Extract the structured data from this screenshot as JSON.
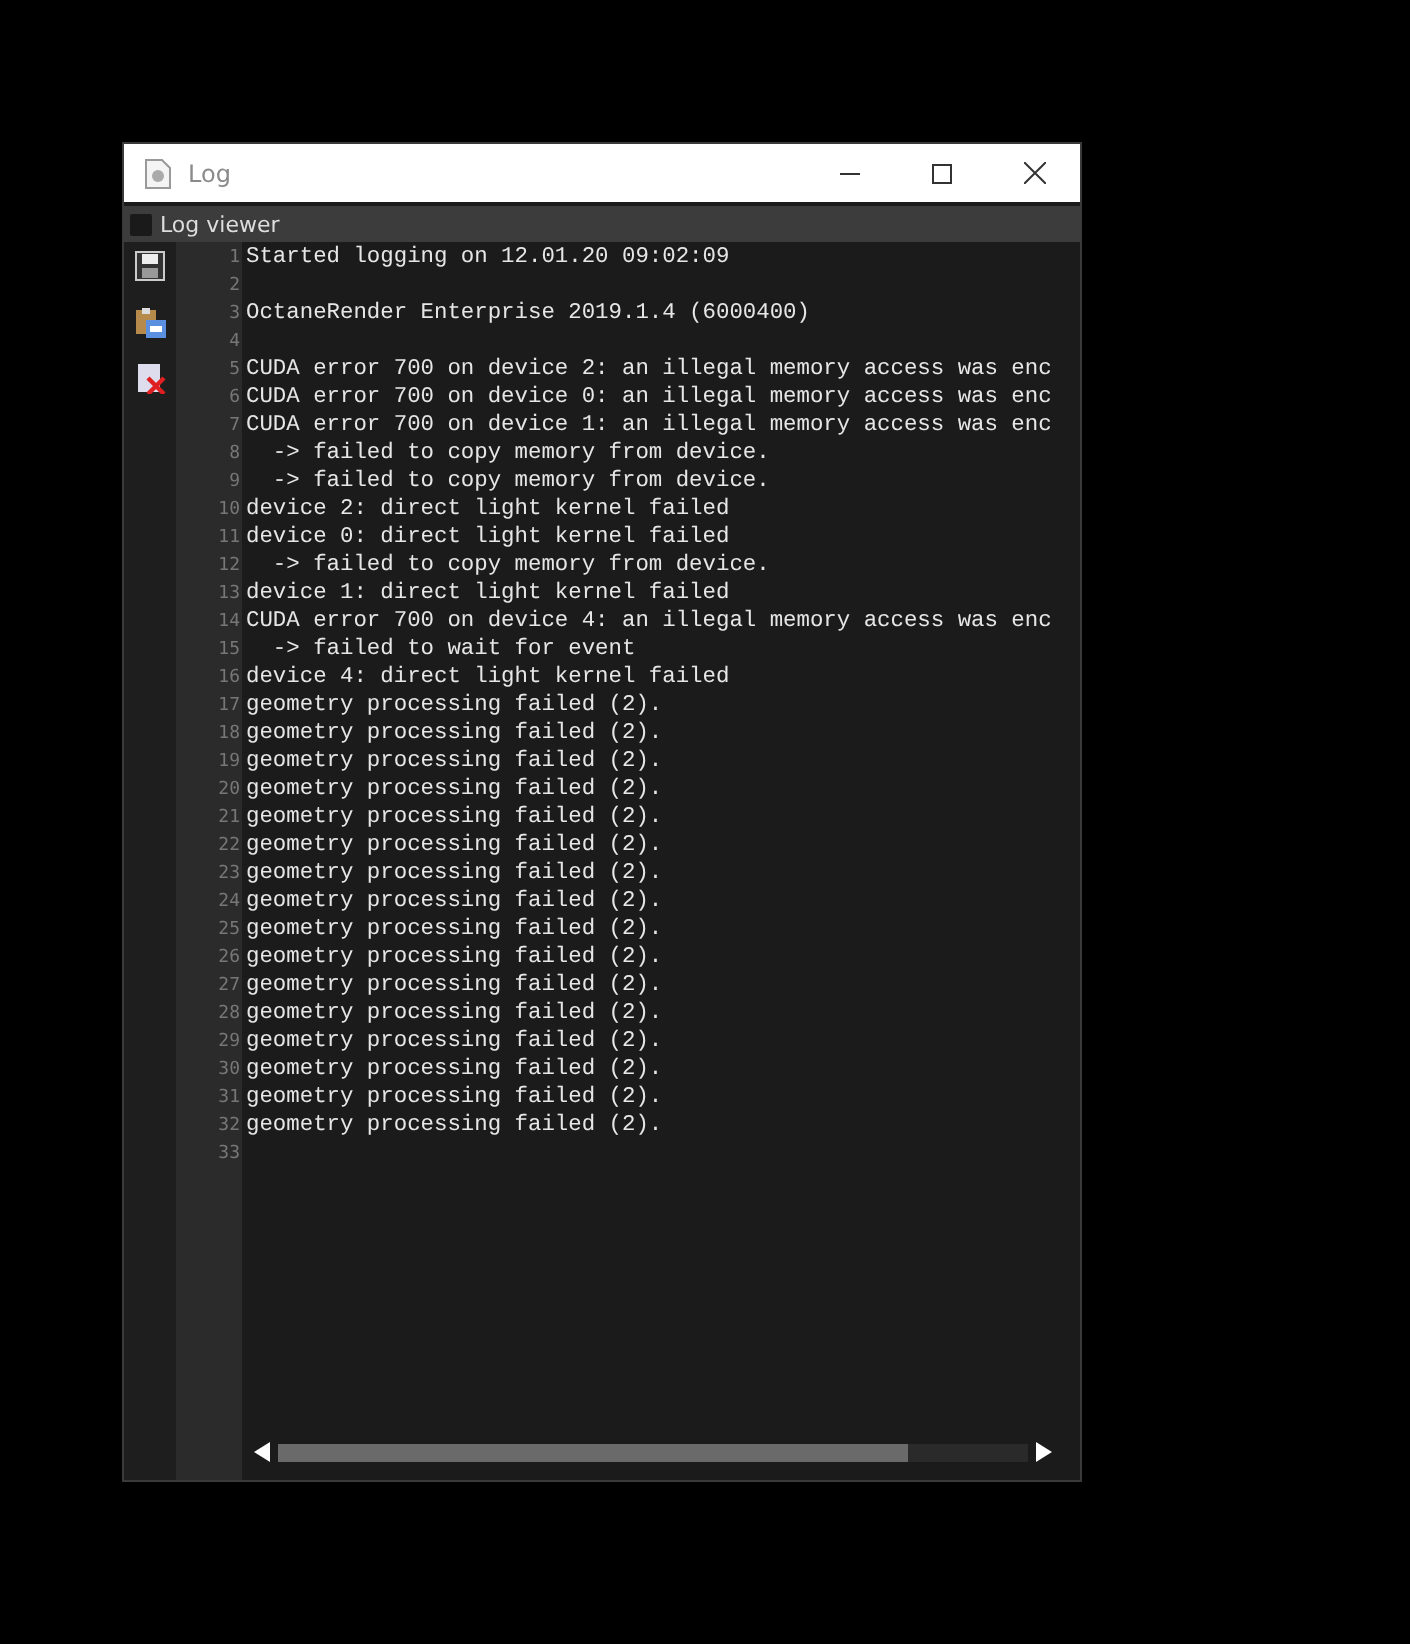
{
  "window": {
    "title": "Log"
  },
  "panel": {
    "label": "Log viewer",
    "checked": false
  },
  "toolbar": [
    {
      "kind": "save"
    },
    {
      "kind": "paste"
    },
    {
      "kind": "clear"
    }
  ],
  "lines": [
    {
      "number": "1",
      "text": "Started logging on 12.01.20 09:02:09"
    },
    {
      "number": "2"
    },
    {
      "number": "3",
      "text": "OctaneRender Enterprise 2019.1.4 (6000400)"
    },
    {
      "number": "4"
    },
    {
      "number": "5",
      "text": "CUDA error 700 on device 2: an illegal memory access was enc"
    },
    {
      "number": "6",
      "text": "CUDA error 700 on device 0: an illegal memory access was enc"
    },
    {
      "number": "7",
      "text": "CUDA error 700 on device 1: an illegal memory access was enc"
    },
    {
      "number": "8",
      "text": "  -> failed to copy memory from device."
    },
    {
      "number": "9",
      "text": "  -> failed to copy memory from device."
    },
    {
      "number": "10",
      "text": "device 2: direct light kernel failed"
    },
    {
      "number": "11",
      "text": "device 0: direct light kernel failed"
    },
    {
      "number": "12",
      "text": "  -> failed to copy memory from device."
    },
    {
      "number": "13",
      "text": "device 1: direct light kernel failed"
    },
    {
      "number": "14",
      "text": "CUDA error 700 on device 4: an illegal memory access was enc"
    },
    {
      "number": "15",
      "text": "  -> failed to wait for event"
    },
    {
      "number": "16",
      "text": "device 4: direct light kernel failed"
    },
    {
      "number": "17",
      "text": "geometry processing failed (2)."
    },
    {
      "number": "18",
      "text": "geometry processing failed (2)."
    },
    {
      "number": "19",
      "text": "geometry processing failed (2)."
    },
    {
      "number": "20",
      "text": "geometry processing failed (2)."
    },
    {
      "number": "21",
      "text": "geometry processing failed (2)."
    },
    {
      "number": "22",
      "text": "geometry processing failed (2)."
    },
    {
      "number": "23",
      "text": "geometry processing failed (2)."
    },
    {
      "number": "24",
      "text": "geometry processing failed (2)."
    },
    {
      "number": "25",
      "text": "geometry processing failed (2)."
    },
    {
      "number": "26",
      "text": "geometry processing failed (2)."
    },
    {
      "number": "27",
      "text": "geometry processing failed (2)."
    },
    {
      "number": "28",
      "text": "geometry processing failed (2)."
    },
    {
      "number": "29",
      "text": "geometry processing failed (2)."
    },
    {
      "number": "30",
      "text": "geometry processing failed (2)."
    },
    {
      "number": "31",
      "text": "geometry processing failed (2)."
    },
    {
      "number": "32",
      "text": "geometry processing failed (2)."
    },
    {
      "number": "33"
    }
  ]
}
